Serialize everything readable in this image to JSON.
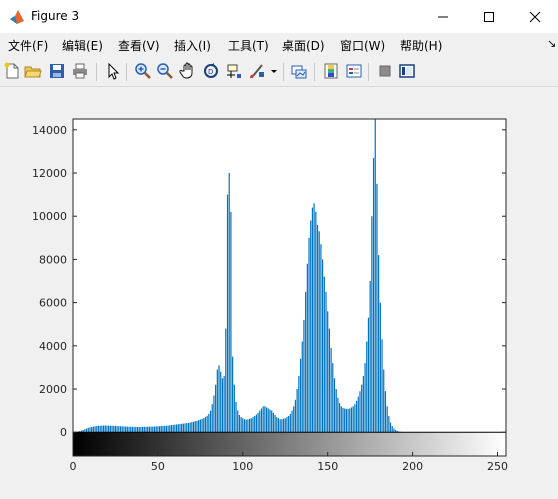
{
  "window": {
    "title": "Figure 3"
  },
  "menu": [
    "文件(F)",
    "编辑(E)",
    "查看(V)",
    "插入(I)",
    "工具(T)",
    "桌面(D)",
    "窗口(W)",
    "帮助(H)"
  ],
  "toolbar_icons": [
    "new-figure-icon",
    "open-file-icon",
    "save-icon",
    "print-icon",
    "pointer-icon",
    "zoom-in-icon",
    "zoom-out-icon",
    "pan-hand-icon",
    "rotate-3d-icon",
    "data-cursor-icon",
    "brush-icon",
    "brush-dropdown-icon",
    "link-plot-icon",
    "insert-colorbar-icon",
    "insert-legend-icon",
    "hide-plot-tools-icon",
    "show-plot-tools-icon"
  ],
  "colors": {
    "bar": "#0072bd",
    "axes_bg": "#ffffff",
    "figure_bg": "#f0f0f0"
  },
  "chart_data": {
    "type": "bar",
    "title": "",
    "xlabel": "",
    "ylabel": "",
    "xlim": [
      0,
      255
    ],
    "ylim": [
      -1100,
      14500
    ],
    "xticks": [
      0,
      50,
      100,
      150,
      200,
      250
    ],
    "yticks": [
      0,
      2000,
      4000,
      6000,
      8000,
      10000,
      12000,
      14000
    ],
    "grid": false,
    "legend": "none",
    "colorbar": "grayscale gradient strip below axis (0 black to 255 white)",
    "x": [
      0,
      1,
      2,
      3,
      4,
      5,
      6,
      7,
      8,
      9,
      10,
      11,
      12,
      13,
      14,
      15,
      16,
      17,
      18,
      19,
      20,
      21,
      22,
      23,
      24,
      25,
      26,
      27,
      28,
      29,
      30,
      31,
      32,
      33,
      34,
      35,
      36,
      37,
      38,
      39,
      40,
      41,
      42,
      43,
      44,
      45,
      46,
      47,
      48,
      49,
      50,
      51,
      52,
      53,
      54,
      55,
      56,
      57,
      58,
      59,
      60,
      61,
      62,
      63,
      64,
      65,
      66,
      67,
      68,
      69,
      70,
      71,
      72,
      73,
      74,
      75,
      76,
      77,
      78,
      79,
      80,
      81,
      82,
      83,
      84,
      85,
      86,
      87,
      88,
      89,
      90,
      91,
      92,
      93,
      94,
      95,
      96,
      97,
      98,
      99,
      100,
      101,
      102,
      103,
      104,
      105,
      106,
      107,
      108,
      109,
      110,
      111,
      112,
      113,
      114,
      115,
      116,
      117,
      118,
      119,
      120,
      121,
      122,
      123,
      124,
      125,
      126,
      127,
      128,
      129,
      130,
      131,
      132,
      133,
      134,
      135,
      136,
      137,
      138,
      139,
      140,
      141,
      142,
      143,
      144,
      145,
      146,
      147,
      148,
      149,
      150,
      151,
      152,
      153,
      154,
      155,
      156,
      157,
      158,
      159,
      160,
      161,
      162,
      163,
      164,
      165,
      166,
      167,
      168,
      169,
      170,
      171,
      172,
      173,
      174,
      175,
      176,
      177,
      178,
      179,
      180,
      181,
      182,
      183,
      184,
      185,
      186,
      187,
      188,
      189,
      190,
      191,
      192,
      193,
      194,
      195,
      196,
      197,
      198,
      199,
      200,
      201,
      202,
      203,
      204,
      205,
      206,
      207,
      208,
      209,
      210,
      211,
      212,
      213,
      214,
      215,
      216,
      217,
      218,
      219,
      220,
      221,
      222,
      223,
      224,
      225,
      226,
      227,
      228,
      229,
      230,
      231,
      232,
      233,
      234,
      235,
      236,
      237,
      238,
      239,
      240,
      241,
      242,
      243,
      244,
      245,
      246,
      247,
      248,
      249,
      250,
      251,
      252,
      253,
      254,
      255
    ],
    "values": [
      5,
      10,
      20,
      35,
      55,
      80,
      110,
      140,
      170,
      200,
      225,
      245,
      260,
      275,
      285,
      295,
      300,
      305,
      310,
      310,
      310,
      305,
      300,
      300,
      295,
      290,
      285,
      280,
      275,
      275,
      270,
      265,
      260,
      255,
      255,
      250,
      250,
      248,
      245,
      245,
      245,
      248,
      250,
      252,
      255,
      258,
      260,
      262,
      265,
      270,
      275,
      280,
      285,
      290,
      295,
      300,
      310,
      320,
      330,
      340,
      350,
      360,
      370,
      380,
      390,
      400,
      410,
      420,
      430,
      450,
      470,
      490,
      510,
      530,
      560,
      590,
      620,
      650,
      700,
      760,
      850,
      1000,
      1300,
      1700,
      2200,
      2900,
      3100,
      2800,
      2500,
      2600,
      4800,
      11000,
      12000,
      10200,
      3500,
      2200,
      1400,
      1000,
      800,
      700,
      650,
      600,
      580,
      600,
      620,
      650,
      700,
      750,
      820,
      900,
      1000,
      1100,
      1200,
      1200,
      1150,
      1100,
      1050,
      1000,
      900,
      800,
      700,
      650,
      600,
      600,
      620,
      650,
      700,
      750,
      850,
      1000,
      1200,
      1500,
      2000,
      2600,
      3400,
      4200,
      5200,
      6500,
      7800,
      9000,
      9800,
      10400,
      10600,
      10200,
      9600,
      9300,
      8700,
      8000,
      7200,
      6500,
      5600,
      4800,
      3900,
      3200,
      2500,
      2000,
      1600,
      1350,
      1200,
      1120,
      1100,
      1080,
      1080,
      1100,
      1150,
      1200,
      1300,
      1450,
      1650,
      1900,
      2200,
      2600,
      3200,
      4200,
      5300,
      7000,
      10000,
      12700,
      14500,
      11500,
      8200,
      6000,
      4300,
      2900,
      1900,
      1200,
      750,
      450,
      280,
      170,
      100,
      60,
      35,
      20,
      10,
      5,
      3,
      2,
      1,
      1,
      0,
      0,
      0,
      0,
      0,
      0,
      0,
      0,
      0,
      0,
      0,
      0,
      0,
      0,
      0,
      0,
      0,
      0,
      0,
      0,
      0,
      0,
      0,
      0,
      0,
      0,
      0,
      0,
      0,
      0,
      0,
      0,
      0,
      0,
      0,
      0,
      0,
      0,
      0,
      0,
      0,
      0,
      0,
      0,
      0
    ]
  }
}
